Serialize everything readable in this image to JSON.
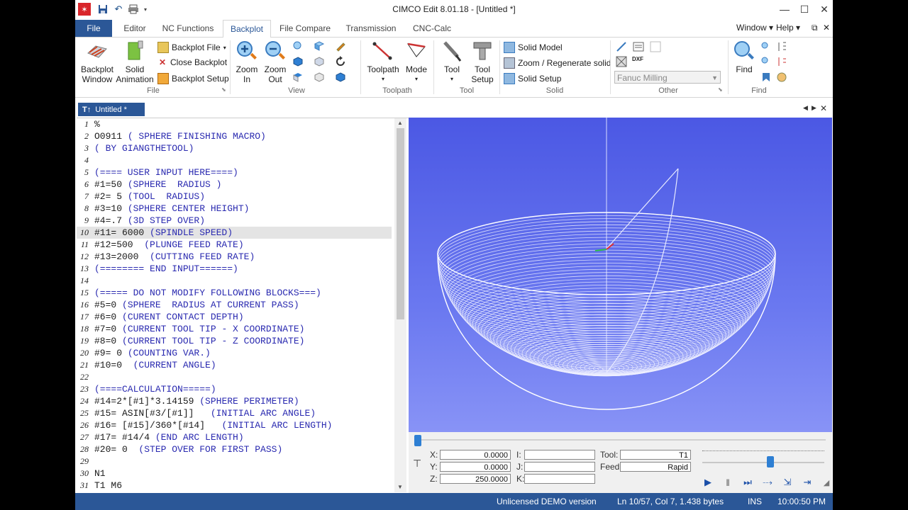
{
  "window": {
    "title": "CIMCO Edit 8.01.18 - [Untitled *]",
    "minimize": "—",
    "maximize": "☐",
    "close": "✕"
  },
  "menu": {
    "file": "File",
    "tabs": [
      "Editor",
      "NC Functions",
      "Backplot",
      "File Compare",
      "Transmission",
      "CNC-Calc"
    ],
    "window": "Window ▾",
    "help": "Help ▾",
    "mdi_restore": "⧉",
    "mdi_close": "✕"
  },
  "ribbon": {
    "file_group": {
      "label": "File",
      "backplot_window": [
        "Backplot",
        "Window"
      ],
      "solid_animation": [
        "Solid",
        "Animation"
      ],
      "backplot_file": "Backplot File",
      "close_backplot": "Close Backplot",
      "backplot_setup": "Backplot Setup"
    },
    "view_group": {
      "label": "View",
      "zoom_in": [
        "Zoom",
        "In"
      ],
      "zoom_out": [
        "Zoom",
        "Out"
      ]
    },
    "toolpath_group": {
      "label": "Toolpath",
      "toolpath": "Toolpath",
      "mode": "Mode"
    },
    "tool_group": {
      "label": "Tool",
      "tool": "Tool",
      "tool_setup": [
        "Tool",
        "Setup"
      ]
    },
    "solid_group": {
      "label": "Solid",
      "solid_model": "Solid Model",
      "zoom_regenerate": "Zoom / Regenerate solid",
      "solid_setup": "Solid Setup"
    },
    "other_group": {
      "label": "Other",
      "machine_select": "Fanuc Milling",
      "dxf_label": "DXF"
    },
    "find_group": {
      "label": "Find",
      "find": "Find"
    }
  },
  "document": {
    "tab_label": "Untitled *",
    "tab_icon": "T↑"
  },
  "editor": {
    "current_line": 10,
    "lines": [
      {
        "n": "1",
        "code": "%",
        "comment": ""
      },
      {
        "n": "2",
        "code": "O0911 ",
        "comment": "( SPHERE FINISHING MACRO)"
      },
      {
        "n": "3",
        "code": "",
        "comment": "( BY GIANGTHETOOL)"
      },
      {
        "n": "4",
        "code": "",
        "comment": ""
      },
      {
        "n": "5",
        "code": "",
        "comment": "(==== USER INPUT HERE====)"
      },
      {
        "n": "6",
        "code": "#1=50 ",
        "comment": "(SPHERE  RADIUS )"
      },
      {
        "n": "7",
        "code": "#2= 5 ",
        "comment": "(TOOL  RADIUS)"
      },
      {
        "n": "8",
        "code": "#3=10 ",
        "comment": "(SPHERE CENTER HEIGHT)"
      },
      {
        "n": "9",
        "code": "#4=.7 ",
        "comment": "(3D STEP OVER)"
      },
      {
        "n": "10",
        "code": "#11= 6000 ",
        "comment": "(SPINDLE SPEED)"
      },
      {
        "n": "11",
        "code": "#12=500  ",
        "comment": "(PLUNGE FEED RATE)"
      },
      {
        "n": "12",
        "code": "#13=2000  ",
        "comment": "(CUTTING FEED RATE)"
      },
      {
        "n": "13",
        "code": "",
        "comment": "(======== END INPUT======)"
      },
      {
        "n": "14",
        "code": "",
        "comment": ""
      },
      {
        "n": "15",
        "code": "",
        "comment": "(===== DO NOT MODIFY FOLLOWING BLOCKS===)"
      },
      {
        "n": "16",
        "code": "#5=0 ",
        "comment": "(SPHERE  RADIUS AT CURRENT PASS)"
      },
      {
        "n": "17",
        "code": "#6=0 ",
        "comment": "(CURENT CONTACT DEPTH)"
      },
      {
        "n": "18",
        "code": "#7=0 ",
        "comment": "(CURRENT TOOL TIP - X COORDINATE)"
      },
      {
        "n": "19",
        "code": "#8=0 ",
        "comment": "(CURRENT TOOL TIP - Z COORDINATE)"
      },
      {
        "n": "20",
        "code": "#9= 0 ",
        "comment": "(COUNTING VAR.)"
      },
      {
        "n": "21",
        "code": "#10=0  ",
        "comment": "(CURRENT ANGLE)"
      },
      {
        "n": "22",
        "code": "",
        "comment": ""
      },
      {
        "n": "23",
        "code": "",
        "comment": "(====CALCULATION=====)"
      },
      {
        "n": "24",
        "code": "#14=2*[#1]*3.14159 ",
        "comment": "(SPHERE PERIMETER)"
      },
      {
        "n": "25",
        "code": "#15= ASIN[#3/[#1]]   ",
        "comment": "(INITIAL ARC ANGLE)"
      },
      {
        "n": "26",
        "code": "#16= [#15]/360*[#14]   ",
        "comment": "(INITIAL ARC LENGTH)"
      },
      {
        "n": "27",
        "code": "#17= #14/4 ",
        "comment": "(END ARC LENGTH)"
      },
      {
        "n": "28",
        "code": "#20= 0  ",
        "comment": "(STEP OVER FOR FIRST PASS)"
      },
      {
        "n": "29",
        "code": "",
        "comment": ""
      },
      {
        "n": "30",
        "code": "N1",
        "comment": ""
      },
      {
        "n": "31",
        "code": "T1 M6",
        "comment": ""
      }
    ]
  },
  "backplot": {
    "fields": {
      "x_label": "X:",
      "x_value": "0.0000",
      "y_label": "Y:",
      "y_value": "0.0000",
      "z_label": "Z:",
      "z_value": "250.0000",
      "i_label": "I:",
      "i_value": "",
      "j_label": "J:",
      "j_value": "",
      "k_label": "K:",
      "k_value": "",
      "tool_label": "Tool:",
      "tool_value": "T1",
      "feed_label": "Feed:",
      "feed_value": "Rapid"
    },
    "progress": 0.0,
    "speed": 0.56
  },
  "status": {
    "demo": "Unlicensed DEMO version",
    "position": "Ln 10/57, Col 7, 1.438 bytes",
    "mode": "INS",
    "time": "10:00:50 PM"
  },
  "colors": {
    "accent": "#2b5797",
    "comment": "#2a2ab0",
    "viewport_top": "#4b58e4",
    "viewport_bottom": "#8893f6"
  }
}
